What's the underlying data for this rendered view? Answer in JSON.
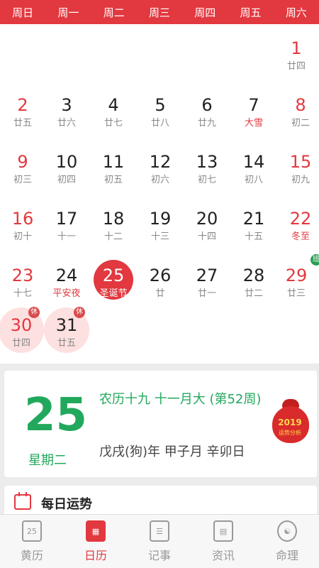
{
  "weekdays": [
    "周日",
    "周一",
    "周二",
    "周三",
    "周四",
    "周五",
    "周六"
  ],
  "calendar": {
    "row1": [
      {
        "num": "1",
        "lunar": "廿四",
        "col": 6
      }
    ],
    "row2": [
      {
        "num": "2",
        "lunar": "廿五",
        "col": 0
      },
      {
        "num": "3",
        "lunar": "廿六",
        "col": 1
      },
      {
        "num": "4",
        "lunar": "廿七",
        "col": 2
      },
      {
        "num": "5",
        "lunar": "廿八",
        "col": 3
      },
      {
        "num": "6",
        "lunar": "廿九",
        "col": 4
      },
      {
        "num": "7",
        "lunar": "大雪",
        "col": 5
      },
      {
        "num": "8",
        "lunar": "初二",
        "col": 6
      }
    ],
    "row3": [
      {
        "num": "9",
        "lunar": "初三",
        "col": 0
      },
      {
        "num": "10",
        "lunar": "初四",
        "col": 1
      },
      {
        "num": "11",
        "lunar": "初五",
        "col": 2
      },
      {
        "num": "12",
        "lunar": "初六",
        "col": 3
      },
      {
        "num": "13",
        "lunar": "初七",
        "col": 4
      },
      {
        "num": "14",
        "lunar": "初八",
        "col": 5
      },
      {
        "num": "15",
        "lunar": "初九",
        "col": 6
      }
    ],
    "row4": [
      {
        "num": "16",
        "lunar": "初十",
        "col": 0
      },
      {
        "num": "17",
        "lunar": "十一",
        "col": 1
      },
      {
        "num": "18",
        "lunar": "十二",
        "col": 2
      },
      {
        "num": "19",
        "lunar": "十三",
        "col": 3
      },
      {
        "num": "20",
        "lunar": "十四",
        "col": 4
      },
      {
        "num": "21",
        "lunar": "十五",
        "col": 5
      },
      {
        "num": "22",
        "lunar": "冬至",
        "col": 6
      }
    ],
    "row5": [
      {
        "num": "23",
        "lunar": "十七",
        "col": 0
      },
      {
        "num": "24",
        "lunar": "平安夜",
        "col": 1
      },
      {
        "num": "25",
        "lunar": "圣诞节",
        "col": 2
      },
      {
        "num": "26",
        "lunar": "廿",
        "col": 3
      },
      {
        "num": "27",
        "lunar": "廿一",
        "col": 4
      },
      {
        "num": "28",
        "lunar": "廿二",
        "col": 5
      },
      {
        "num": "29",
        "lunar": "廿三",
        "col": 6
      }
    ],
    "row6": [
      {
        "num": "30",
        "lunar": "廿四",
        "col": 0
      },
      {
        "num": "31",
        "lunar": "廿五",
        "col": 1
      }
    ],
    "badge_rest": "休",
    "badge_work": "班"
  },
  "detail": {
    "day": "25",
    "weekday": "星期二",
    "lunar_info": "农历十九 十一月大 (第52周)",
    "ganzhi": "戊戌(狗)年 甲子月 辛卯日",
    "bag_year": "2019",
    "bag_sub": "运势分析"
  },
  "fortune": {
    "title": "每日运势"
  },
  "tabs": [
    {
      "label": "黄历",
      "icon_text": "25"
    },
    {
      "label": "日历",
      "icon_text": "▦"
    },
    {
      "label": "记事",
      "icon_text": "☰"
    },
    {
      "label": "资讯",
      "icon_text": "▤"
    },
    {
      "label": "命理",
      "icon_text": "☯"
    }
  ],
  "colors": {
    "accent": "#e2383f",
    "green": "#22a85c"
  }
}
